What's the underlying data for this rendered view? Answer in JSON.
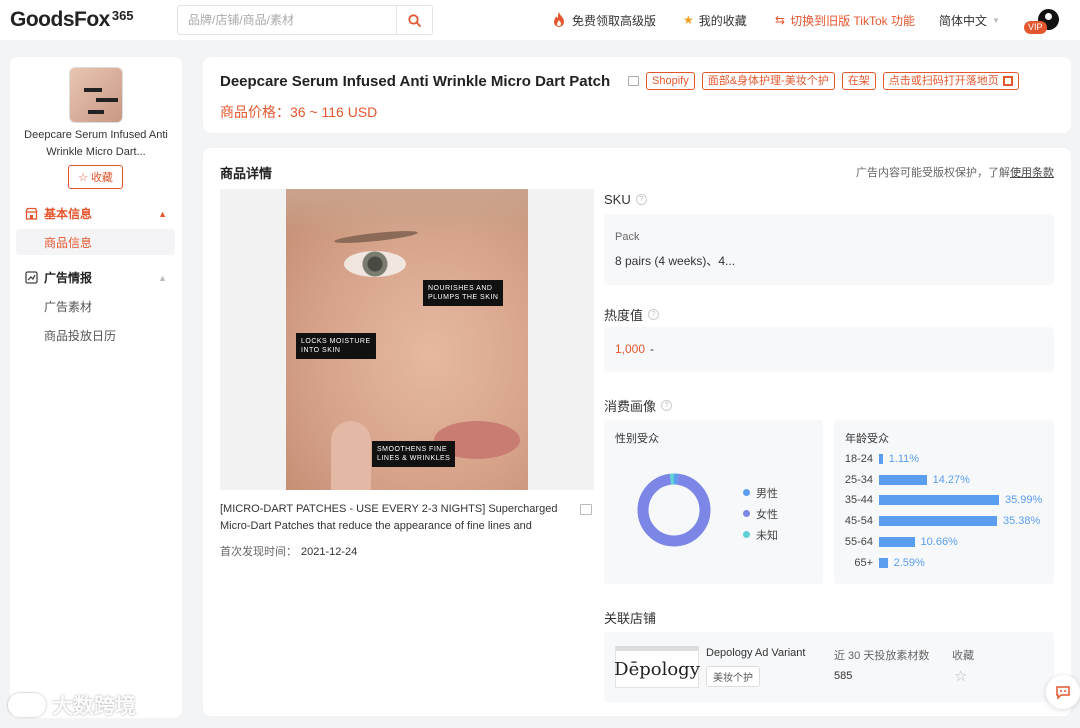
{
  "app": {
    "logo": "GoodsFox",
    "logo_suffix": "365",
    "search_placeholder": "品牌/店铺/商品/素材",
    "nav": {
      "promo": "免费领取高级版",
      "favorites": "我的收藏",
      "switch": "切换到旧版 TikTok 功能",
      "language": "简体中文"
    },
    "vip_badge": "VIP"
  },
  "sidebar": {
    "product_name": "Deepcare Serum Infused Anti Wrinkle Micro Dart...",
    "fav_button": "收藏",
    "sections": [
      {
        "label": "基本信息",
        "items": [
          "商品信息"
        ]
      },
      {
        "label": "广告情报",
        "items": [
          "广告素材",
          "商品投放日历"
        ]
      }
    ]
  },
  "header": {
    "title": "Deepcare Serum Infused Anti Wrinkle Micro Dart Patch",
    "tags": [
      "Shopify",
      "面部&身体护理-美妆个护",
      "在架",
      "点击或扫码打开落地页"
    ],
    "price_label": "商品价格：",
    "price": "36 ~ 116 USD"
  },
  "detail": {
    "title": "商品详情",
    "notice_text": "广告内容可能受版权保护，了解",
    "notice_link": "使用条款",
    "image_callouts": [
      "NOURISHES AND",
      "PLUMPS THE SKIN",
      "LOCKS MOISTURE",
      "INTO SKIN",
      "SMOOTHENS FINE",
      "LINES & WRINKLES"
    ],
    "caption": "[MICRO-DART PATCHES - USE EVERY 2-3 NIGHTS] Supercharged Micro-Dart Patches that reduce the appearance of fine lines and",
    "found_label": "首次发现时间：",
    "found_date": "2021-12-24",
    "sku": {
      "label": "SKU",
      "key": "Pack",
      "value": "8 pairs (4 weeks)、4..."
    },
    "heat": {
      "label": "热度值",
      "value": "1,000",
      "suffix": "-"
    },
    "audience_label": "消费画像",
    "gender": {
      "title": "性别受众",
      "legend": [
        "男性",
        "女性",
        "未知"
      ]
    },
    "age_title": "年龄受众",
    "store": {
      "label": "关联店铺",
      "logo_text": "Dēpology",
      "name": "Depology Ad Variant",
      "category": "美妆个护",
      "metric_label": "近 30 天投放素材数",
      "metric_value": "585",
      "fav_label": "收藏"
    }
  },
  "watermark": "大数跨境",
  "colors": {
    "accent": "#e4572e",
    "male": "#5b9ef0",
    "female": "#7b86e6",
    "unknown": "#5fd0d6",
    "bar": "#5b9ef0"
  },
  "chart_data": [
    {
      "type": "pie",
      "title": "性别受众",
      "categories": [
        "男性",
        "女性",
        "未知"
      ],
      "values": [
        2,
        96,
        2
      ]
    },
    {
      "type": "bar",
      "title": "年龄受众",
      "orientation": "horizontal",
      "categories": [
        "18-24",
        "25-34",
        "35-44",
        "45-54",
        "55-64",
        "65+"
      ],
      "values": [
        1.11,
        14.27,
        35.99,
        35.38,
        10.66,
        2.59
      ],
      "value_labels": [
        "1.11%",
        "14.27%",
        "35.99%",
        "35.38%",
        "10.66%",
        "2.59%"
      ]
    }
  ]
}
